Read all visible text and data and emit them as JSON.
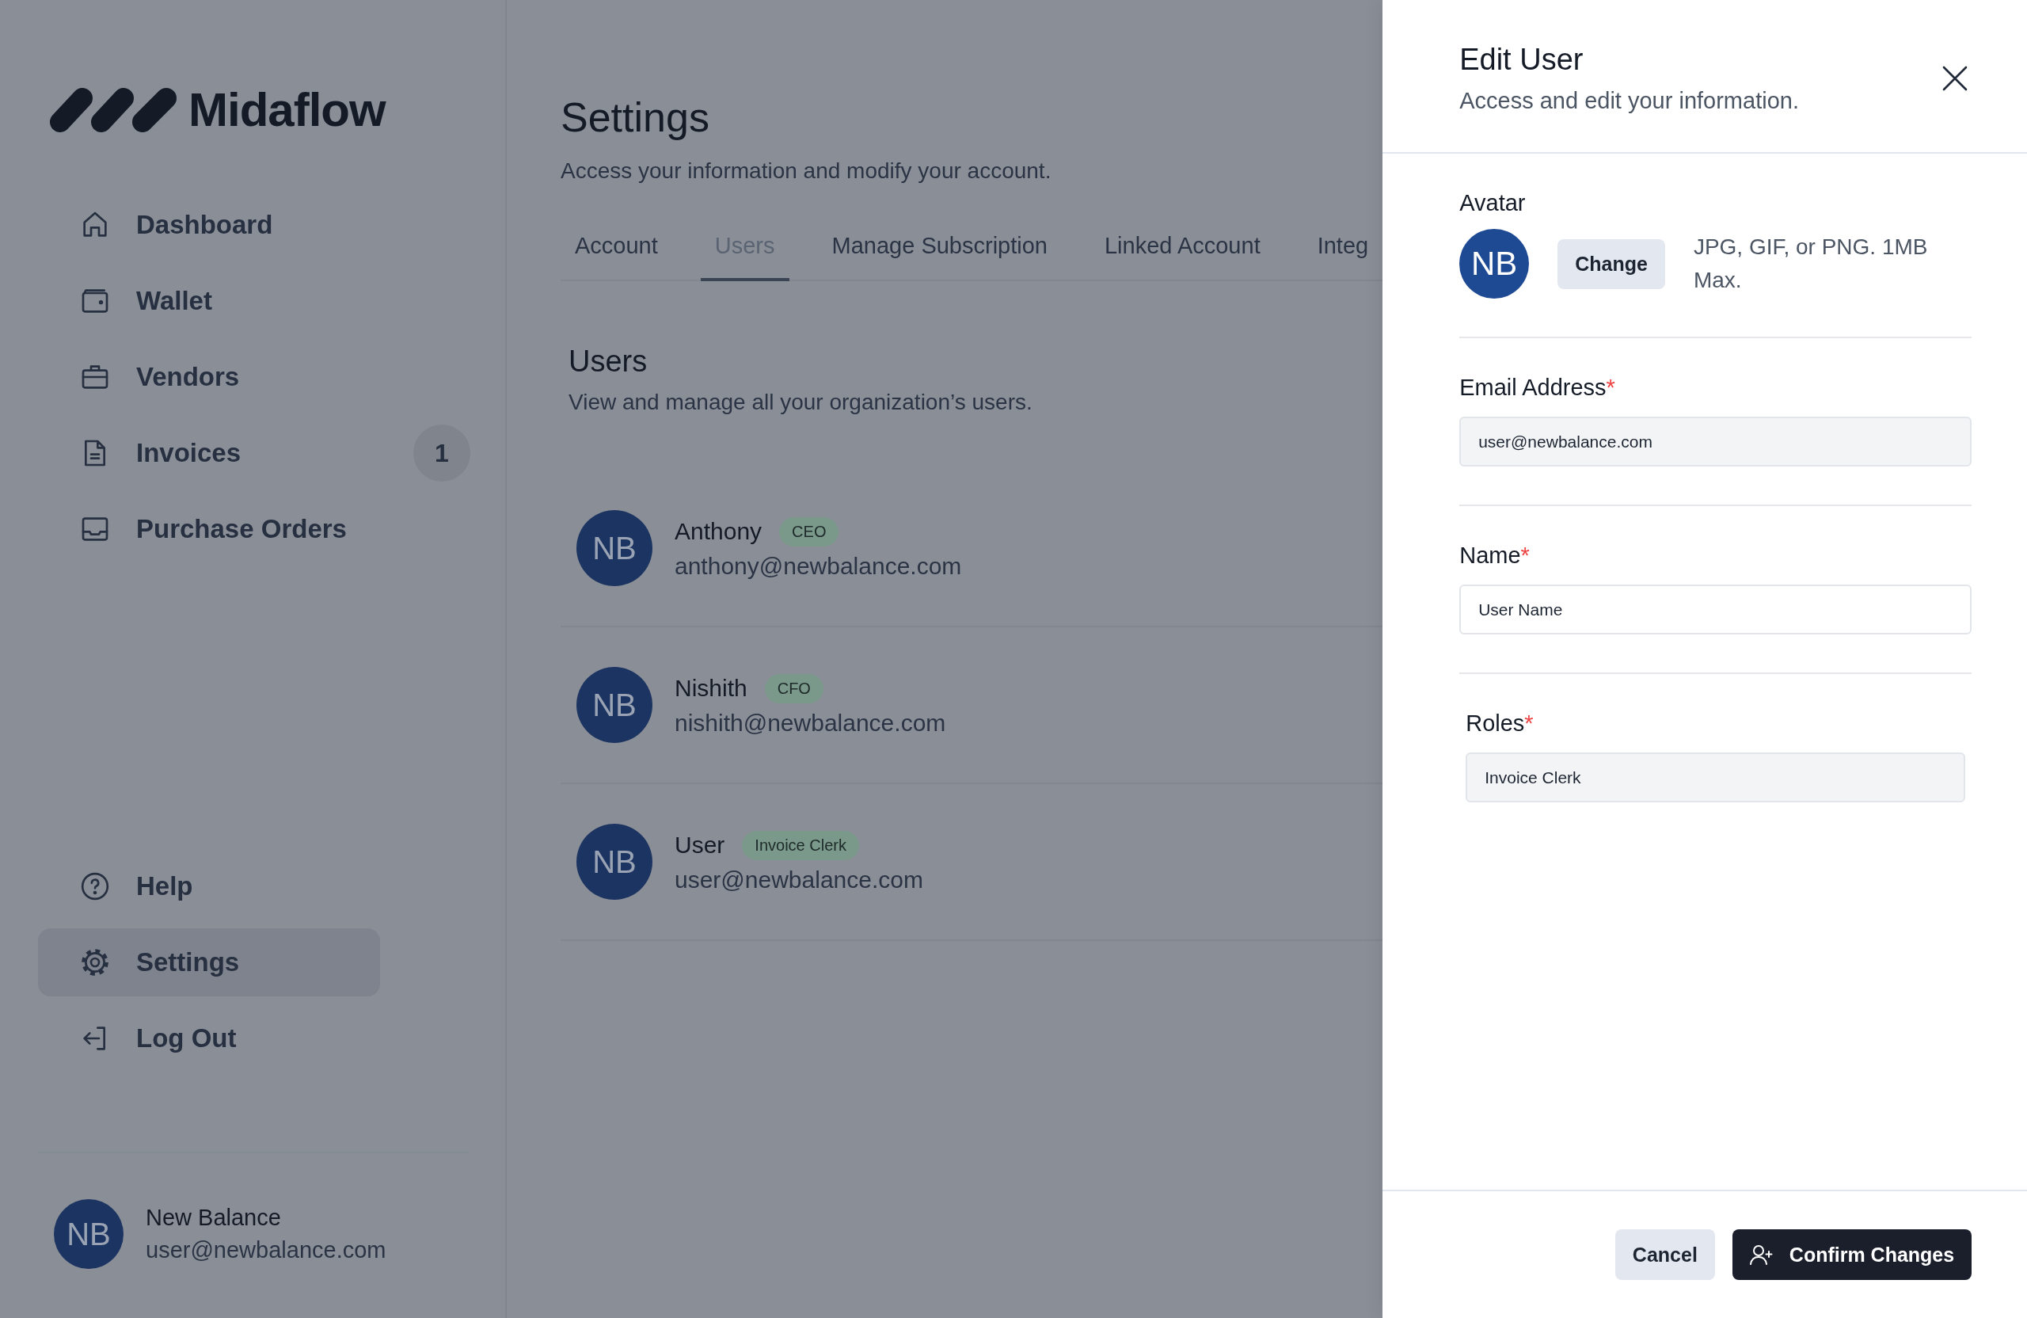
{
  "sidebar": {
    "logo": "Midaflow",
    "nav": [
      {
        "label": "Dashboard",
        "selected": false
      },
      {
        "label": "Wallet",
        "selected": false
      },
      {
        "label": "Vendors",
        "selected": false
      },
      {
        "label": "Invoices",
        "selected": false,
        "badge": "1"
      },
      {
        "label": "Purchase Orders",
        "selected": false
      }
    ],
    "bottom_nav": [
      {
        "label": "Help",
        "selected": false
      },
      {
        "label": "Settings",
        "selected": true
      },
      {
        "label": "Log Out",
        "selected": false
      }
    ],
    "profile": {
      "initials": "NB",
      "name": "New Balance",
      "email": "user@newbalance.com"
    }
  },
  "main": {
    "title": "Settings",
    "subtitle": "Access your information and modify your account.",
    "tabs": [
      {
        "label": "Account",
        "selected": false
      },
      {
        "label": "Users",
        "selected": true
      },
      {
        "label": "Manage Subscription",
        "selected": false
      },
      {
        "label": "Linked Account",
        "selected": false
      },
      {
        "label": "Integ",
        "selected": false
      }
    ],
    "section": {
      "title": "Users",
      "subtitle": "View and manage all your organization’s users."
    },
    "users": [
      {
        "initials": "NB",
        "name": "Anthony",
        "role": "CEO",
        "email": "anthony@newbalance.com"
      },
      {
        "initials": "NB",
        "name": "Nishith",
        "role": "CFO",
        "email": "nishith@newbalance.com"
      },
      {
        "initials": "NB",
        "name": "User",
        "role": "Invoice Clerk",
        "email": "user@newbalance.com"
      }
    ]
  },
  "drawer": {
    "title": "Edit User",
    "subtitle": "Access and edit your information.",
    "avatar": {
      "label": "Avatar",
      "initials": "NB",
      "button": "Change",
      "hint": "JPG, GIF, or PNG. 1MB Max."
    },
    "fields": [
      {
        "label": "Email Address",
        "required_mark": "*",
        "value": "user@newbalance.com",
        "disabled": true
      },
      {
        "label": "Name",
        "required_mark": "*",
        "value": "User Name",
        "disabled": false
      },
      {
        "label": "Roles",
        "required_mark": "*",
        "value": "Invoice Clerk",
        "disabled": true
      }
    ],
    "buttons": [
      {
        "label": "Cancel",
        "kind": "secondary"
      },
      {
        "label": "Confirm Changes",
        "kind": "primary"
      }
    ]
  }
}
